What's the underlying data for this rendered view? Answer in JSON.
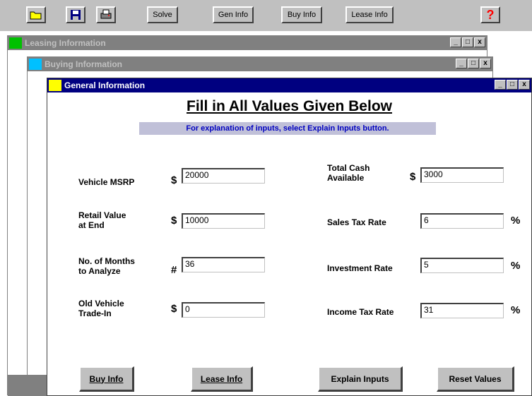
{
  "toolbar": {
    "buttons": [
      {
        "icon": "open-folder-icon"
      },
      {
        "icon": "save-disk-icon"
      },
      {
        "icon": "printer-icon"
      }
    ],
    "solve_label": "Solve",
    "gen_info_label": "Gen Info",
    "buy_info_label": "Buy Info",
    "lease_info_label": "Lease Info",
    "help_label": "?"
  },
  "windows": {
    "leasing_title": "Leasing Information",
    "buying_title": "Buying Information",
    "general_title": "General Information"
  },
  "window_buttons": {
    "minimize": "_",
    "restore": "□",
    "close": "x"
  },
  "main": {
    "heading": "Fill in All Values Given Below",
    "hint": "For explanation of inputs, select Explain Inputs button."
  },
  "fields": {
    "msrp": {
      "label1": "Vehicle MSRP",
      "label2": "",
      "symbol": "$",
      "value": "20000"
    },
    "retail": {
      "label1": "Retail Value",
      "label2": "at End",
      "symbol": "$",
      "value": "10000"
    },
    "months": {
      "label1": "No. of Months",
      "label2": "to Analyze",
      "symbol": "#",
      "value": "36"
    },
    "tradein": {
      "label1": "Old Vehicle",
      "label2": "Trade-In",
      "symbol": "$",
      "value": "0"
    },
    "cash": {
      "label1": "Total Cash",
      "label2": "Available",
      "symbol": "$",
      "value": "3000"
    },
    "salestax": {
      "label1": "Sales Tax Rate",
      "symbol": "%",
      "value": "6"
    },
    "investment": {
      "label1": "Investment Rate",
      "symbol": "%",
      "value": "5"
    },
    "incometax": {
      "label1": "Income Tax Rate",
      "symbol": "%",
      "value": "31"
    }
  },
  "buttons": {
    "buy_info": "Buy Info",
    "lease_info": "Lease Info",
    "explain_inputs": "Explain Inputs",
    "reset_values": "Reset Values"
  }
}
